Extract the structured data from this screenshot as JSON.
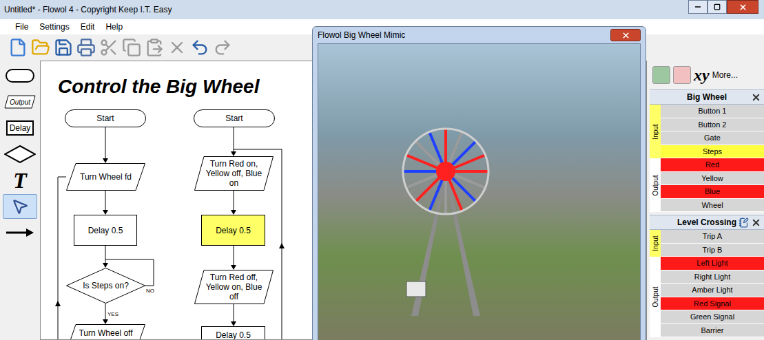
{
  "window": {
    "title": "Untitled* - Flowol 4 - Copyright Keep I.T. Easy"
  },
  "menu": [
    "File",
    "Settings",
    "Edit",
    "Help"
  ],
  "palette": [
    {
      "kind": "start",
      "label": "",
      "selected": false
    },
    {
      "kind": "output",
      "label": "Output",
      "selected": false
    },
    {
      "kind": "delay",
      "label": "Delay",
      "selected": false
    },
    {
      "kind": "decision",
      "label": "",
      "selected": false
    },
    {
      "kind": "text",
      "label": "T",
      "selected": false
    },
    {
      "kind": "pointer",
      "label": "",
      "selected": true
    },
    {
      "kind": "arrow",
      "label": "",
      "selected": false
    }
  ],
  "canvas": {
    "title": "Control the Big Wheel",
    "flowcharts": [
      {
        "nodes": [
          {
            "kind": "start",
            "text": "Start",
            "active": false
          },
          {
            "kind": "output",
            "text": "Turn Wheel fd",
            "active": false
          },
          {
            "kind": "delay",
            "text": "Delay 0.5",
            "active": false
          },
          {
            "kind": "decision",
            "text": "Is Steps on?",
            "active": false,
            "no": "NO",
            "yes": "YES"
          },
          {
            "kind": "output",
            "text": "Turn Wheel off",
            "active": false
          }
        ]
      },
      {
        "nodes": [
          {
            "kind": "start",
            "text": "Start",
            "active": false
          },
          {
            "kind": "output",
            "text": "Turn Red on, Yellow off, Blue on",
            "active": false
          },
          {
            "kind": "delay",
            "text": "Delay 0.5",
            "active": true
          },
          {
            "kind": "output",
            "text": "Turn Red off, Yellow on, Blue off",
            "active": false
          },
          {
            "kind": "delay",
            "text": "Delay 0.5",
            "active": false
          }
        ]
      }
    ]
  },
  "mimic": {
    "title": "Flowol Big Wheel Mimic"
  },
  "panel": {
    "xy": "xy",
    "more": "More...",
    "devices": [
      {
        "name": "Big Wheel",
        "groups": [
          {
            "kind": "input",
            "label": "Input",
            "items": [
              {
                "name": "Button 1",
                "on": false
              },
              {
                "name": "Button 2",
                "on": false
              },
              {
                "name": "Gate",
                "on": false
              },
              {
                "name": "Steps",
                "on": true
              }
            ]
          },
          {
            "kind": "output",
            "label": "Output",
            "items": [
              {
                "name": "Red",
                "on": true,
                "color": "#ff2020"
              },
              {
                "name": "Yellow",
                "on": false,
                "color": "#ffe000"
              },
              {
                "name": "Blue",
                "on": true,
                "color": "#2040ff"
              },
              {
                "name": "Wheel",
                "on": false
              }
            ]
          }
        ]
      },
      {
        "name": "Level Crossing",
        "groups": [
          {
            "kind": "input",
            "label": "Input",
            "items": [
              {
                "name": "Trip A",
                "on": false
              },
              {
                "name": "Trip B",
                "on": false
              }
            ]
          },
          {
            "kind": "output",
            "label": "Output",
            "items": [
              {
                "name": "Left Light",
                "on": true
              },
              {
                "name": "Right Light",
                "on": false
              },
              {
                "name": "Amber Light",
                "on": false
              },
              {
                "name": "Red Signal",
                "on": true
              },
              {
                "name": "Green Signal",
                "on": false
              },
              {
                "name": "Barrier",
                "on": false
              }
            ]
          }
        ]
      }
    ]
  }
}
